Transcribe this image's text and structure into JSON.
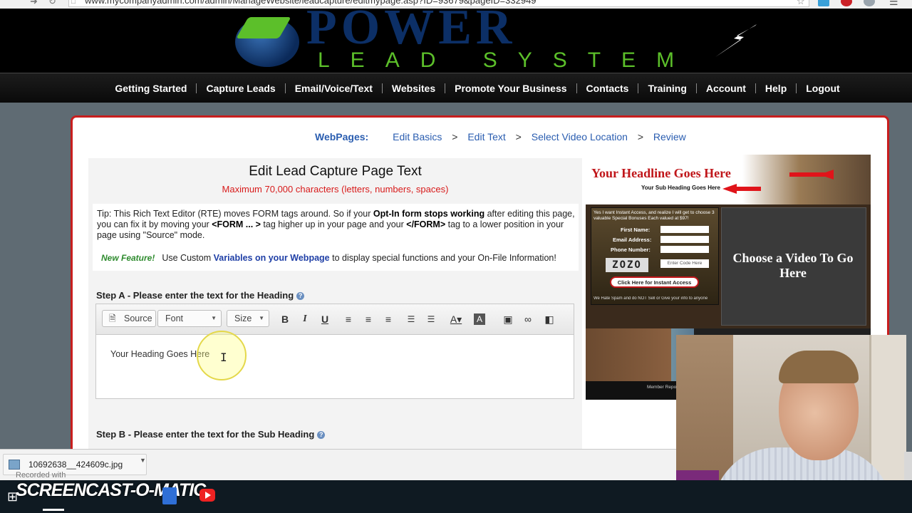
{
  "browser": {
    "url": "www.mycompanyadmin.com/admin/ManageWebsite/leadcapture/editmypage.asp?ID=93679&pageID=332949"
  },
  "header": {
    "logo_main": "POWER",
    "logo_sub": "LEAD SYSTEM"
  },
  "menu": {
    "items": [
      "Getting Started",
      "Capture Leads",
      "Email/Voice/Text",
      "Websites",
      "Promote Your Business",
      "Contacts",
      "Training",
      "Account",
      "Help",
      "Logout"
    ]
  },
  "breadcrumb": {
    "label": "WebPages:",
    "steps": [
      "Edit Basics",
      "Edit Text",
      "Select Video Location",
      "Review"
    ],
    "separator": ">"
  },
  "editor": {
    "title": "Edit Lead Capture Page Text",
    "limit": "Maximum 70,000 characters (letters, numbers, spaces)",
    "tip_prefix": "Tip: This Rich Text Editor (RTE) moves FORM tags around. So if your ",
    "tip_bold1": "Opt-In form stops working",
    "tip_mid1": " after editing this page, you can fix it by moving your ",
    "tip_bold2": "<FORM ... >",
    "tip_mid2": " tag higher up in your page and your ",
    "tip_bold3": "</FORM>",
    "tip_suffix": " tag to a lower position in your page using \"Source\" mode.",
    "new_feature_badge": "New Feature!",
    "new_feature_prefix": "Use Custom ",
    "new_feature_link": "Variables on your Webpage",
    "new_feature_suffix": " to display special functions and your On-File Information!",
    "step_a_label": "Step A - Please enter the text for the Heading",
    "step_b_label": "Step B - Please enter the text for the Sub Heading",
    "toolbar": {
      "source_label": "Source",
      "font_label": "Font",
      "size_label": "Size"
    },
    "heading_value": "Your Heading Goes Here"
  },
  "preview": {
    "headline": "Your Headline Goes Here",
    "subheading": "Your Sub Heading Goes Here",
    "form_intro": "Yes I want Instant Access, and realize I will get to choose 3 valuable Special Bonuses Each valued at $97!",
    "first_name": "First Name:",
    "email": "Email Address:",
    "phone": "Phone Number:",
    "captcha": "ZOZO",
    "code_placeholder": "Enter Code Here",
    "button": "Click Here for Instant Access",
    "spam_note": "We Hate Spam and do NOT Sell or Give your info to anyone",
    "video_text": "Choose a Video To Go Here",
    "footer_text": "Member Repo"
  },
  "downloads": {
    "file_name": "10692638__424609c.jpg"
  },
  "taskbar": {
    "recorded_with": "Recorded with",
    "watermark": "SCREENCAST-O-MATIC"
  },
  "colors": {
    "accent_red": "#c81e1e",
    "link_blue": "#2a5db0",
    "logo_green": "#5cbf2a",
    "logo_blue": "#0c2f66"
  }
}
